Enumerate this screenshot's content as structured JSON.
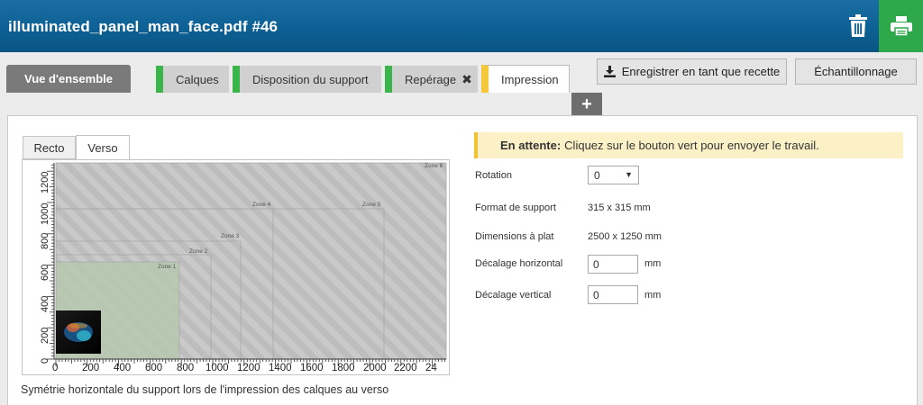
{
  "header": {
    "title": "illuminated_panel_man_face.pdf #46"
  },
  "colors": {
    "header_blue": "#0c5f92",
    "print_green": "#2ea84b",
    "step_done": "#3ab54a",
    "step_pending": "#f5c73a"
  },
  "icons": {
    "trash": "trash-icon",
    "print": "printer-icon",
    "download": "download-icon",
    "add": "plus-icon",
    "remove": "x-icon"
  },
  "tabs": {
    "overview": "Vue d'ensemble",
    "calques": "Calques",
    "disposition": "Disposition du support",
    "reperage": "Repérage",
    "impression": "Impression"
  },
  "toolbar": {
    "save_recipe": "Enregistrer en tant que recette",
    "sampling": "Échantillonnage"
  },
  "preview": {
    "tabs": {
      "recto": "Recto",
      "verso": "Verso"
    },
    "x_ticks": [
      "0",
      "200",
      "400",
      "600",
      "800",
      "1000",
      "1200",
      "1400",
      "1600",
      "1800",
      "2000",
      "2200",
      "24"
    ],
    "y_ticks": [
      "0",
      "200",
      "400",
      "600",
      "800",
      "1000",
      "1200"
    ],
    "zones": {
      "z1": "Zone 1",
      "z2": "Zone 2",
      "z3": "Zone 3",
      "z4": "Zone 4",
      "z5": "Zone 5",
      "z6": "Zone 6"
    },
    "caption": "Symétrie horizontale du support lors de l'impression des calques au verso"
  },
  "status": {
    "title": "En attente:",
    "message": "Cliquez sur le bouton vert pour envoyer le travail."
  },
  "settings": {
    "rotation": {
      "label": "Rotation",
      "value": "0"
    },
    "media_format": {
      "label": "Format de support",
      "value": "315 x 315 mm"
    },
    "flat_dims": {
      "label": "Dimensions à plat",
      "value": "2500 x 1250 mm"
    },
    "h_offset": {
      "label": "Décalage horizontal",
      "value": "0",
      "unit": "mm"
    },
    "v_offset": {
      "label": "Décalage vertical",
      "value": "0",
      "unit": "mm"
    }
  }
}
